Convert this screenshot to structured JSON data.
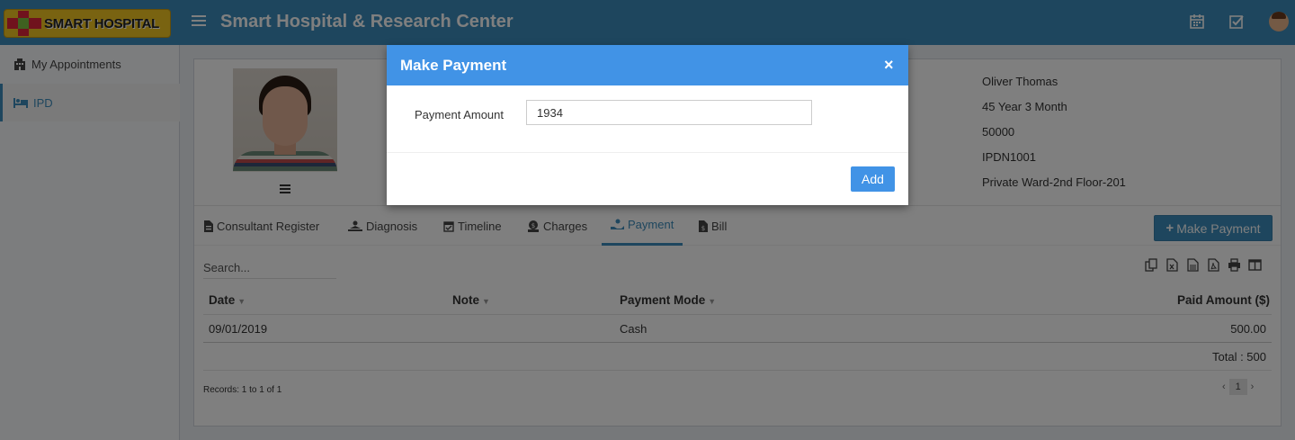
{
  "header": {
    "logo_text": "SMART HOSPITAL",
    "app_title": "Smart Hospital & Research Center",
    "icons": [
      "calendar-icon",
      "check-square-icon",
      "user-avatar"
    ]
  },
  "sidebar": {
    "items": [
      {
        "label": "My Appointments",
        "icon": "building-icon",
        "active": false
      },
      {
        "label": "IPD",
        "icon": "bed-icon",
        "active": true
      }
    ]
  },
  "patient": {
    "details": [
      "Oliver Thomas",
      "45 Year 3 Month",
      "50000",
      "IPDN1001",
      "Private Ward-2nd Floor-201"
    ]
  },
  "tabs": [
    {
      "label": "Consultant Register",
      "icon": "file-icon"
    },
    {
      "label": "Diagnosis",
      "icon": "diagnosis-icon"
    },
    {
      "label": "Timeline",
      "icon": "calendar-check-icon"
    },
    {
      "label": "Charges",
      "icon": "charges-icon"
    },
    {
      "label": "Payment",
      "icon": "hand-coin-icon",
      "active": true
    },
    {
      "label": "Bill",
      "icon": "bill-icon"
    }
  ],
  "make_payment_button": "Make Payment",
  "search": {
    "placeholder": "Search..."
  },
  "table": {
    "columns": [
      "Date",
      "Note",
      "Payment Mode",
      "Paid Amount ($)"
    ],
    "rows": [
      {
        "date": "09/01/2019",
        "note": "",
        "mode": "Cash",
        "amount": "500.00"
      }
    ],
    "total": "Total : 500",
    "records": "Records: 1 to 1 of 1",
    "page": "1"
  },
  "modal": {
    "title": "Make Payment",
    "close": "×",
    "amount_label": "Payment Amount",
    "amount_value": "1934",
    "add_button": "Add"
  },
  "colors": {
    "primary": "#3c8dbc",
    "modal_header": "#4193e6"
  }
}
